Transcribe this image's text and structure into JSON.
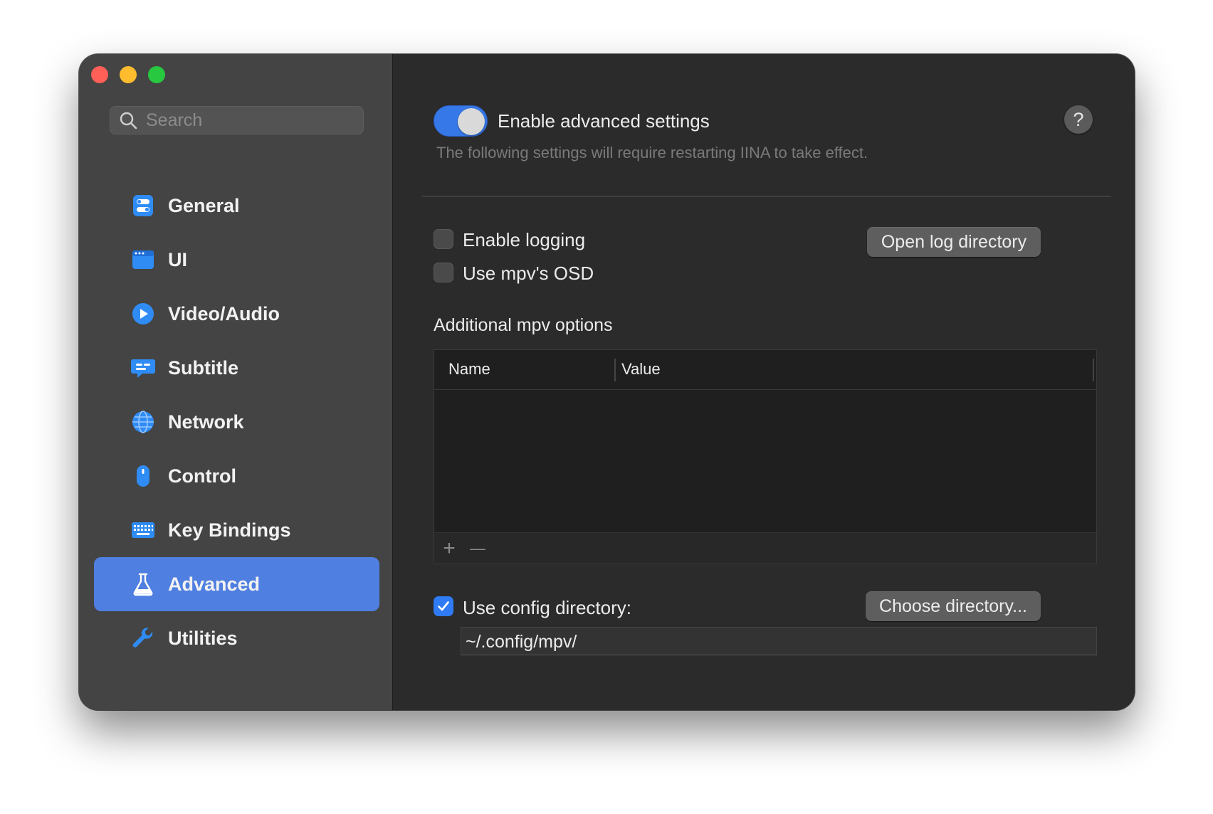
{
  "window": {
    "traffic_lights": [
      "close",
      "minimize",
      "zoom"
    ]
  },
  "sidebar": {
    "search": {
      "placeholder": "Search",
      "value": ""
    },
    "items": [
      {
        "label": "General",
        "icon": "general-toggles-icon",
        "active": false
      },
      {
        "label": "UI",
        "icon": "ui-window-icon",
        "active": false
      },
      {
        "label": "Video/Audio",
        "icon": "play-circle-icon",
        "active": false
      },
      {
        "label": "Subtitle",
        "icon": "subtitle-bubble-icon",
        "active": false
      },
      {
        "label": "Network",
        "icon": "globe-icon",
        "active": false
      },
      {
        "label": "Control",
        "icon": "mouse-icon",
        "active": false
      },
      {
        "label": "Key Bindings",
        "icon": "keyboard-icon",
        "active": false
      },
      {
        "label": "Advanced",
        "icon": "flask-icon",
        "active": true
      },
      {
        "label": "Utilities",
        "icon": "wrench-icon",
        "active": false
      }
    ]
  },
  "main": {
    "advanced_toggle": {
      "label": "Enable advanced settings",
      "on": true
    },
    "hint": "The following settings will require restarting IINA to take effect.",
    "help_label": "?",
    "enable_logging": {
      "label": "Enable logging",
      "checked": false
    },
    "open_log_button": "Open log directory",
    "use_mpv_osd": {
      "label": "Use mpv's OSD",
      "checked": false
    },
    "mpv_options": {
      "title": "Additional mpv options",
      "columns": [
        "Name",
        "Value"
      ],
      "rows": [],
      "add_label": "+",
      "remove_label": "—"
    },
    "use_config_dir": {
      "label": "Use config directory:",
      "checked": true
    },
    "choose_dir_button": "Choose directory...",
    "config_path": "~/.config/mpv/"
  },
  "colors": {
    "accent": "#4f7fe0",
    "toggle_on": "#3778e8",
    "checkbox_on": "#2f7bf5",
    "sidebar_bg": "#444444",
    "main_bg": "#2b2b2b",
    "icon_blue": "#2f8cf5"
  }
}
